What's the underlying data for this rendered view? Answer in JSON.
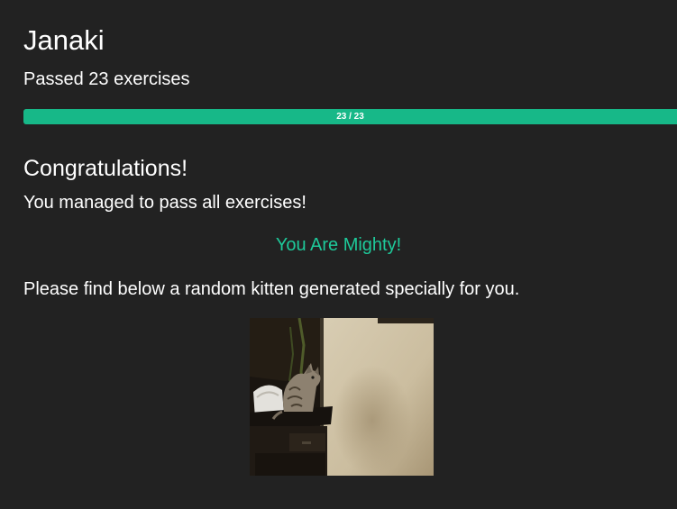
{
  "user": {
    "name": "Janaki",
    "passed_text": "Passed 23 exercises"
  },
  "progress": {
    "completed": 23,
    "total": 23,
    "fraction": 1.0,
    "label": "23 / 23",
    "fill_color": "#17b888"
  },
  "congrats": {
    "title": "Congratulations!",
    "message": "You managed to pass all exercises!",
    "mighty": "You Are Mighty!",
    "mighty_color": "#1ec99a"
  },
  "kitten": {
    "intro": "Please find below a random kitten generated specially for you.",
    "image_name": "kitten-photo"
  },
  "theme": {
    "background": "#222222",
    "text": "#ffffff"
  }
}
